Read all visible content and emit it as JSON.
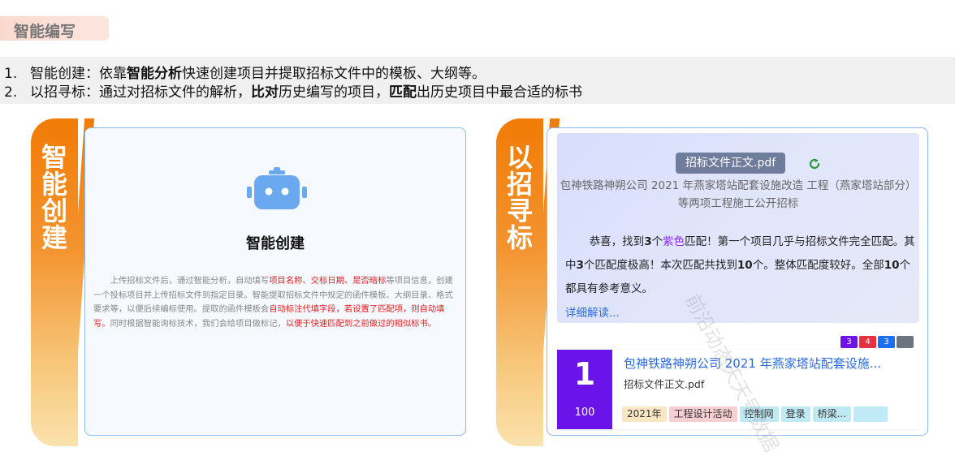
{
  "section": {
    "title": "智能编写"
  },
  "intro": {
    "items": [
      {
        "num": "1.",
        "prefix": "智能创建：依靠",
        "bold1": "智能分析",
        "rest": "快速创建项目并提取招标文件中的模板、大纲等。"
      },
      {
        "num": "2.",
        "prefix": "以招寻标：通过对招标文件的解析，",
        "bold1": "比对",
        "mid": "历史编写的项目，",
        "bold2": "匹配",
        "rest": "出历史项目中最合适的标书"
      }
    ]
  },
  "ribbons": {
    "left": "智能创建",
    "right": "以招寻标"
  },
  "create_card": {
    "title": "智能创建",
    "desc_1": "上传招标文件后，通过智能分析，自动填写",
    "desc_red_1": "项目名称、交标日期、是否暗标",
    "desc_2": "等项目信息，创建一个投标项目并上传招标文件到指定目录。智能提取招标文件中规定的函件模板、大纲目录、格式要求等，以便后续编标使用。提取的函件模板会",
    "desc_red_2": "自动标注代填字段，若设置了匹配项，则自动填写。",
    "desc_3": "同时根据智能询标技术，我们会给项目做标记，",
    "desc_red_3": "以便于快速匹配到之前做过的相似标书。"
  },
  "match_card": {
    "file_chip": "招标文件正文.pdf",
    "project_name": "包神铁路神朔公司 2021 年燕家塔站配套设施改造 工程（燕家塔站部分）等两项工程施工公开招标",
    "msg": {
      "p1": "恭喜，找到",
      "n1": "3",
      "p2": "个",
      "purple": "紫色",
      "p3": "匹配！第一个项目几乎与招标文件完全匹配。其中",
      "n2": "3",
      "p4": "个匹配度极高！本次匹配共找到",
      "n3": "10",
      "p5": "个。整体匹配度较好。全部",
      "n4": "10",
      "p6": "个都具有参考意义。"
    },
    "detail_link": "详细解读...",
    "counts": [
      {
        "value": "3",
        "color": "#6f14e8"
      },
      {
        "value": "4",
        "color": "#e23341"
      },
      {
        "value": "3",
        "color": "#1d6ff2"
      },
      {
        "value": "",
        "color": "#6c757d"
      }
    ],
    "result": {
      "rank": "1",
      "score": "100",
      "title": "包神铁路神朔公司 2021 年燕家塔站配套设施...",
      "file": "招标文件正文.pdf",
      "tags": [
        {
          "label": "2021年",
          "bg": "#f7e7c2"
        },
        {
          "label": "工程设计活动",
          "bg": "#f6cfd3"
        },
        {
          "label": "控制网",
          "bg": "#bfe9f3"
        },
        {
          "label": "登录",
          "bg": "#bfe9f3"
        },
        {
          "label": "桥梁...",
          "bg": "#bfe9f3"
        },
        {
          "label": "",
          "bg": "#bfeaf6"
        }
      ]
    }
  },
  "watermark": "前沿动态天天号数据"
}
